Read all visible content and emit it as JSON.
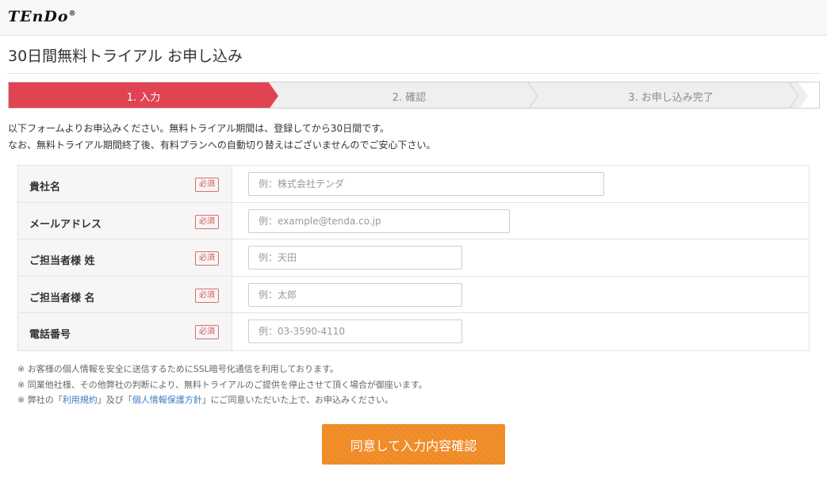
{
  "header": {
    "logo_text": "TEnDo",
    "logo_mark": "®"
  },
  "page": {
    "title": "30日間無料トライアル お申し込み"
  },
  "steps": [
    {
      "label": "1. 入力",
      "active": true
    },
    {
      "label": "2. 確認",
      "active": false
    },
    {
      "label": "3. お申し込み完了",
      "active": false
    }
  ],
  "intro": {
    "line1": "以下フォームよりお申込みください。無料トライアル期間は、登録してから30日間です。",
    "line2": "なお、無料トライアル期間終了後、有料プランへの自動切り替えはございませんのでご安心下さい。"
  },
  "form": {
    "required_label": "必須",
    "fields": [
      {
        "label": "貴社名",
        "placeholder": "例：株式会社テンダ",
        "value": ""
      },
      {
        "label": "メールアドレス",
        "placeholder": "例：example@tenda.co.jp",
        "value": ""
      },
      {
        "label": "ご担当者様 姓",
        "placeholder": "例：天田",
        "value": ""
      },
      {
        "label": "ご担当者様 名",
        "placeholder": "例：太郎",
        "value": ""
      },
      {
        "label": "電話番号",
        "placeholder": "例：03-3590-4110",
        "value": ""
      }
    ]
  },
  "notes": {
    "line1": "※ お客様の個人情報を安全に送信するためにSSL暗号化通信を利用しております。",
    "line2": "※ 同業他社様、その他弊社の判断により、無料トライアルのご提供を停止させて頂く場合が御座います。",
    "line3_prefix": "※ 弊社の「",
    "terms_link": "利用規約",
    "line3_mid": "」及び「",
    "privacy_link": "個人情報保護方針",
    "line3_suffix": "」にご同意いただいた上で、お申込みください。"
  },
  "submit": {
    "label": "同意して入力内容確認"
  },
  "colors": {
    "active_step": "#e04452",
    "inactive_step": "#efefef",
    "submit": "#f08a24",
    "link": "#3b7dc4"
  }
}
